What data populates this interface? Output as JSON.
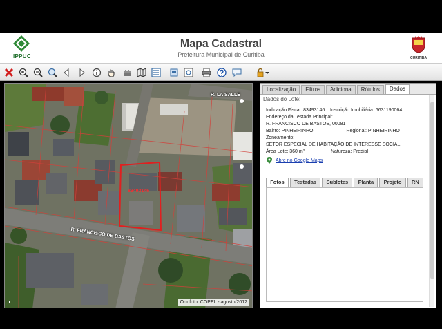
{
  "header": {
    "logo_text": "IPPUC",
    "title": "Mapa Cadastral",
    "subtitle": "Prefeitura Municipal de Curitiba",
    "crest_text": "CURITIBA"
  },
  "toolbar": {
    "icons": [
      "close-icon",
      "zoom-in-icon",
      "zoom-out-icon",
      "zoom-extent-icon",
      "back-icon",
      "forward-icon",
      "info-icon",
      "pan-hand-icon",
      "measure-icon",
      "map-layers-icon",
      "legend-icon",
      "export-icon",
      "preview-icon",
      "print-icon",
      "help-icon",
      "comment-icon",
      "lock-icon"
    ]
  },
  "map": {
    "street_1": "R. LA SALLE",
    "street_2": "R. FRANCISCO DE BASTOS",
    "lot_label": "83493146",
    "credit": "Ortofoto: COPEL - agosto/2012"
  },
  "panel": {
    "tabs": [
      "Localização",
      "Filtros",
      "Adiciona",
      "Rótulos",
      "Dados"
    ],
    "active_tab": "Dados",
    "section_title": "Dados do Lote:",
    "indicacao_label": "Indicação Fiscal:",
    "indicacao_value": "83493146",
    "inscricao_label": "Inscrição Imobiliária:",
    "inscricao_value": "6631190064",
    "endereco_label": "Endereço da Testada Principal:",
    "endereco_value": "R. FRANCISCO DE BASTOS, 00081",
    "bairro_label": "Bairro:",
    "bairro_value": "PINHEIRINHO",
    "regional_label": "Regional:",
    "regional_value": "PINHEIRINHO",
    "zoneamento_label": "Zoneamento:",
    "zoneamento_value": "SETOR ESPECIAL DE HABITAÇÃO DE INTERESSE SOCIAL",
    "area_label": "Área Lote:",
    "area_value": "360 m²",
    "natureza_label": "Natureza:",
    "natureza_value": "Predial",
    "google_link": "Abre no Google Maps",
    "subtabs": [
      "Fotos",
      "Testadas",
      "Sublotes",
      "Planta",
      "Projeto",
      "RN"
    ],
    "active_subtab": "Fotos"
  }
}
